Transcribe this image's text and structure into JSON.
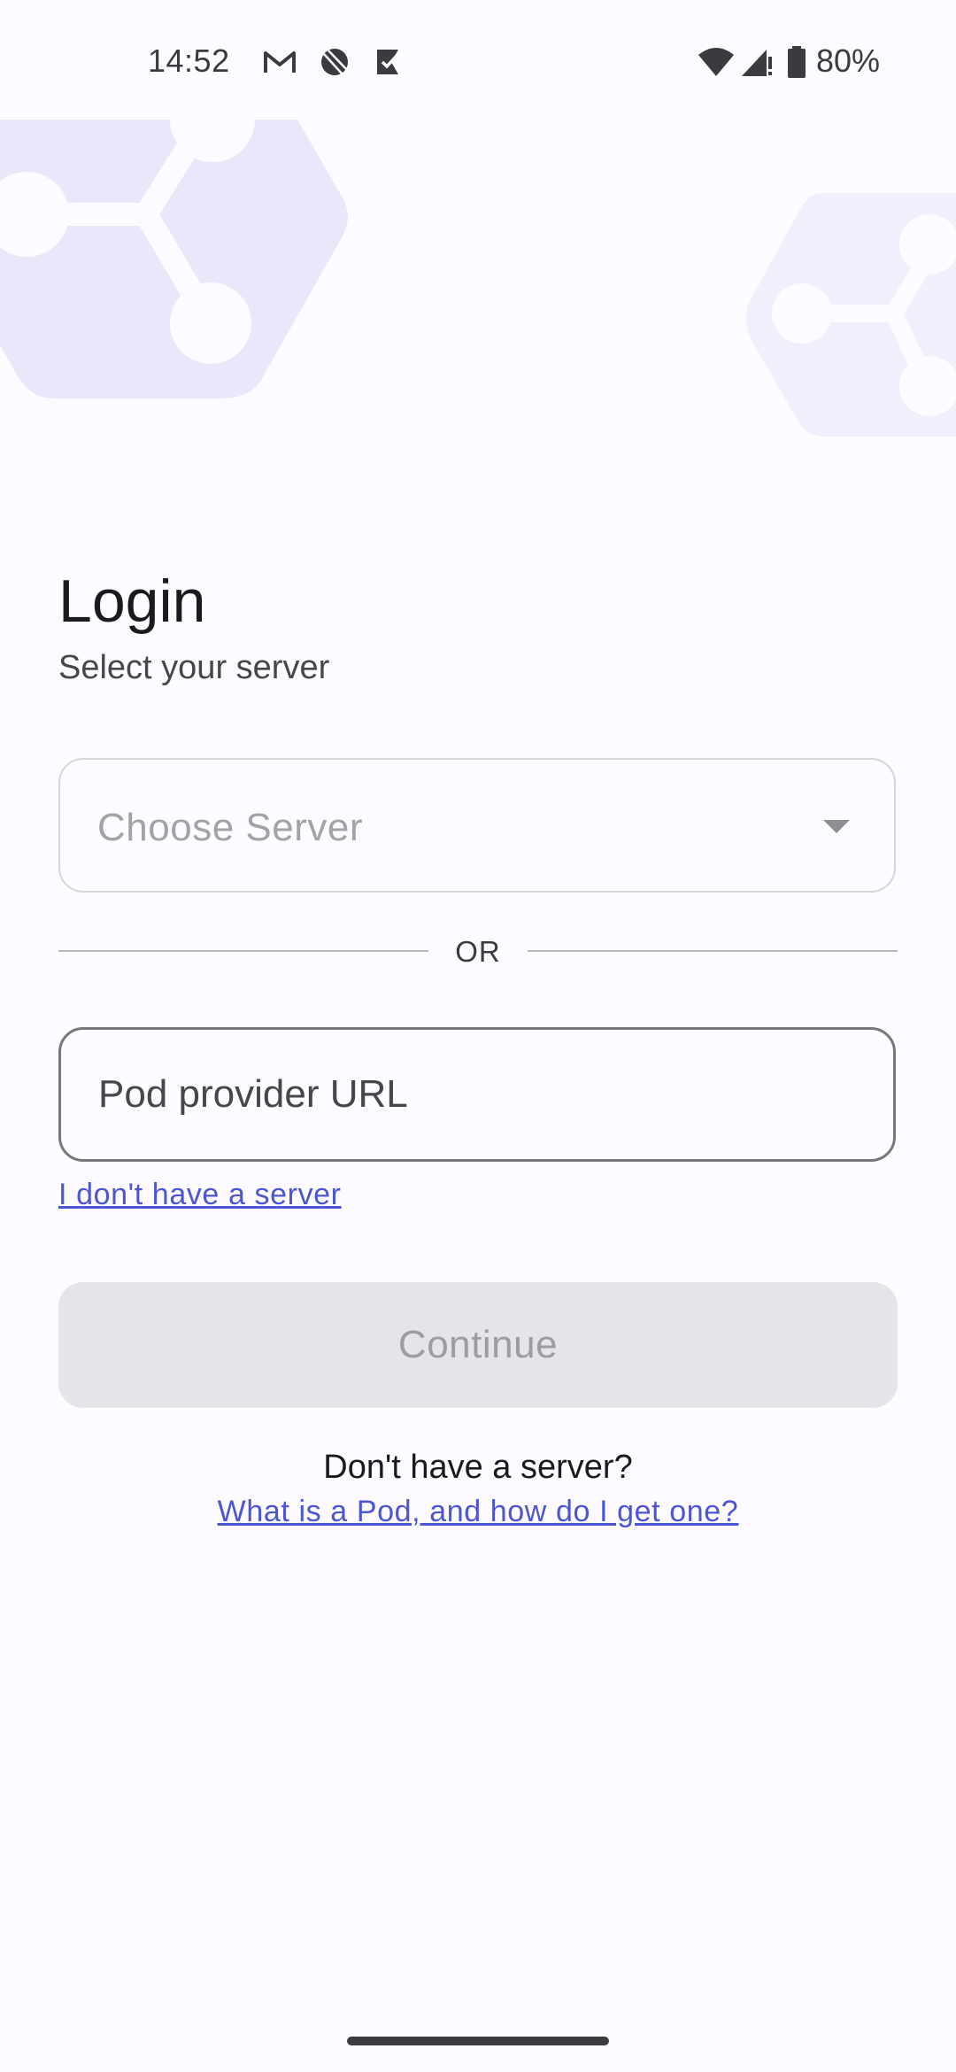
{
  "status_bar": {
    "time": "14:52",
    "notification_icons": [
      "gmail-icon",
      "app-icon",
      "tasks-icon"
    ],
    "system_icons": [
      "wifi-icon",
      "signal-icon",
      "battery-icon"
    ],
    "battery_text": "80%"
  },
  "login": {
    "title": "Login",
    "subtitle": "Select your server",
    "server_select": {
      "placeholder": "Choose Server"
    },
    "divider_text": "OR",
    "url_input": {
      "placeholder": "Pod provider URL",
      "value": ""
    },
    "no_server_link": "I don't have a server",
    "continue_label": "Continue",
    "help_question": "Don't have a server?",
    "help_link": "What is a Pod, and how do I get one?"
  },
  "colors": {
    "background": "#fdfbff",
    "accent_link": "#4d55d3",
    "decor_hexagon": "#e9e8fb",
    "disabled_button": "#e5e4e9",
    "disabled_text": "#9d9ca3"
  }
}
